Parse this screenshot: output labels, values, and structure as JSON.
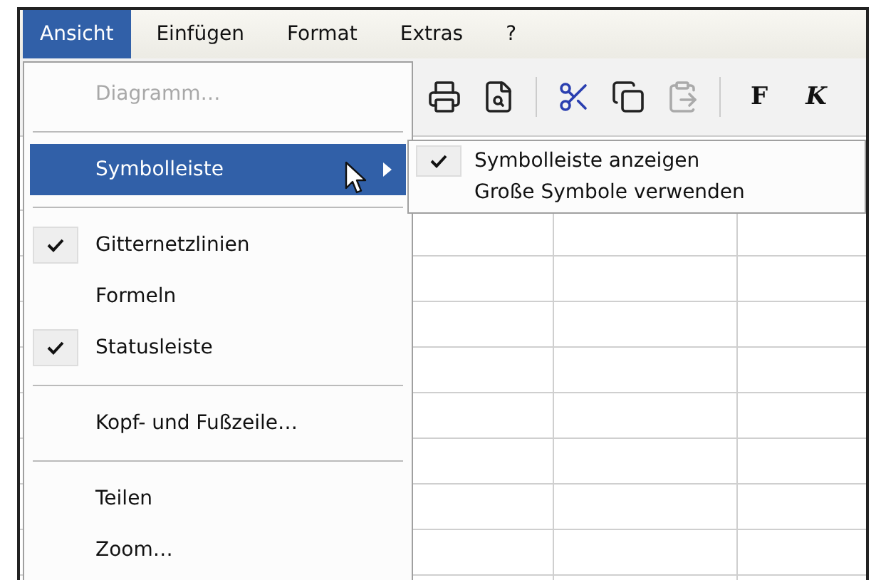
{
  "menubar": [
    {
      "label": "Ansicht",
      "selected": true
    },
    {
      "label": "Einfügen",
      "selected": false
    },
    {
      "label": "Format",
      "selected": false
    },
    {
      "label": "Extras",
      "selected": false
    },
    {
      "label": "?",
      "selected": false
    }
  ],
  "toolbar": {
    "buttons": [
      {
        "kind": "print",
        "disabled": false
      },
      {
        "kind": "preview",
        "disabled": false
      },
      {
        "kind": "separator"
      },
      {
        "kind": "cut",
        "disabled": false
      },
      {
        "kind": "copy",
        "disabled": false
      },
      {
        "kind": "paste",
        "disabled": true
      },
      {
        "kind": "separator"
      },
      {
        "kind": "bold",
        "label": "F",
        "disabled": false
      },
      {
        "kind": "italic",
        "label": "K",
        "disabled": false
      }
    ]
  },
  "menu": {
    "items": [
      {
        "kind": "item",
        "label": "Diagramm…",
        "disabled": true,
        "checked": false,
        "selected": false,
        "submenu": false
      },
      {
        "kind": "separator"
      },
      {
        "kind": "item",
        "label": "Symbolleiste",
        "disabled": false,
        "checked": false,
        "selected": true,
        "submenu": true
      },
      {
        "kind": "separator"
      },
      {
        "kind": "item",
        "label": "Gitternetzlinien",
        "disabled": false,
        "checked": true,
        "selected": false,
        "submenu": false
      },
      {
        "kind": "item",
        "label": "Formeln",
        "disabled": false,
        "checked": false,
        "selected": false,
        "submenu": false
      },
      {
        "kind": "item",
        "label": "Statusleiste",
        "disabled": false,
        "checked": true,
        "selected": false,
        "submenu": false
      },
      {
        "kind": "separator"
      },
      {
        "kind": "item",
        "label": "Kopf- und Fußzeile…",
        "disabled": false,
        "checked": false,
        "selected": false,
        "submenu": false
      },
      {
        "kind": "separator"
      },
      {
        "kind": "item",
        "label": "Teilen",
        "disabled": false,
        "checked": false,
        "selected": false,
        "submenu": false
      },
      {
        "kind": "item",
        "label": "Zoom…",
        "disabled": false,
        "checked": false,
        "selected": false,
        "submenu": false
      }
    ]
  },
  "submenu": {
    "items": [
      {
        "label": "Symbolleiste anzeigen",
        "checked": true
      },
      {
        "label": "Große Symbole verwenden",
        "checked": false
      }
    ]
  }
}
